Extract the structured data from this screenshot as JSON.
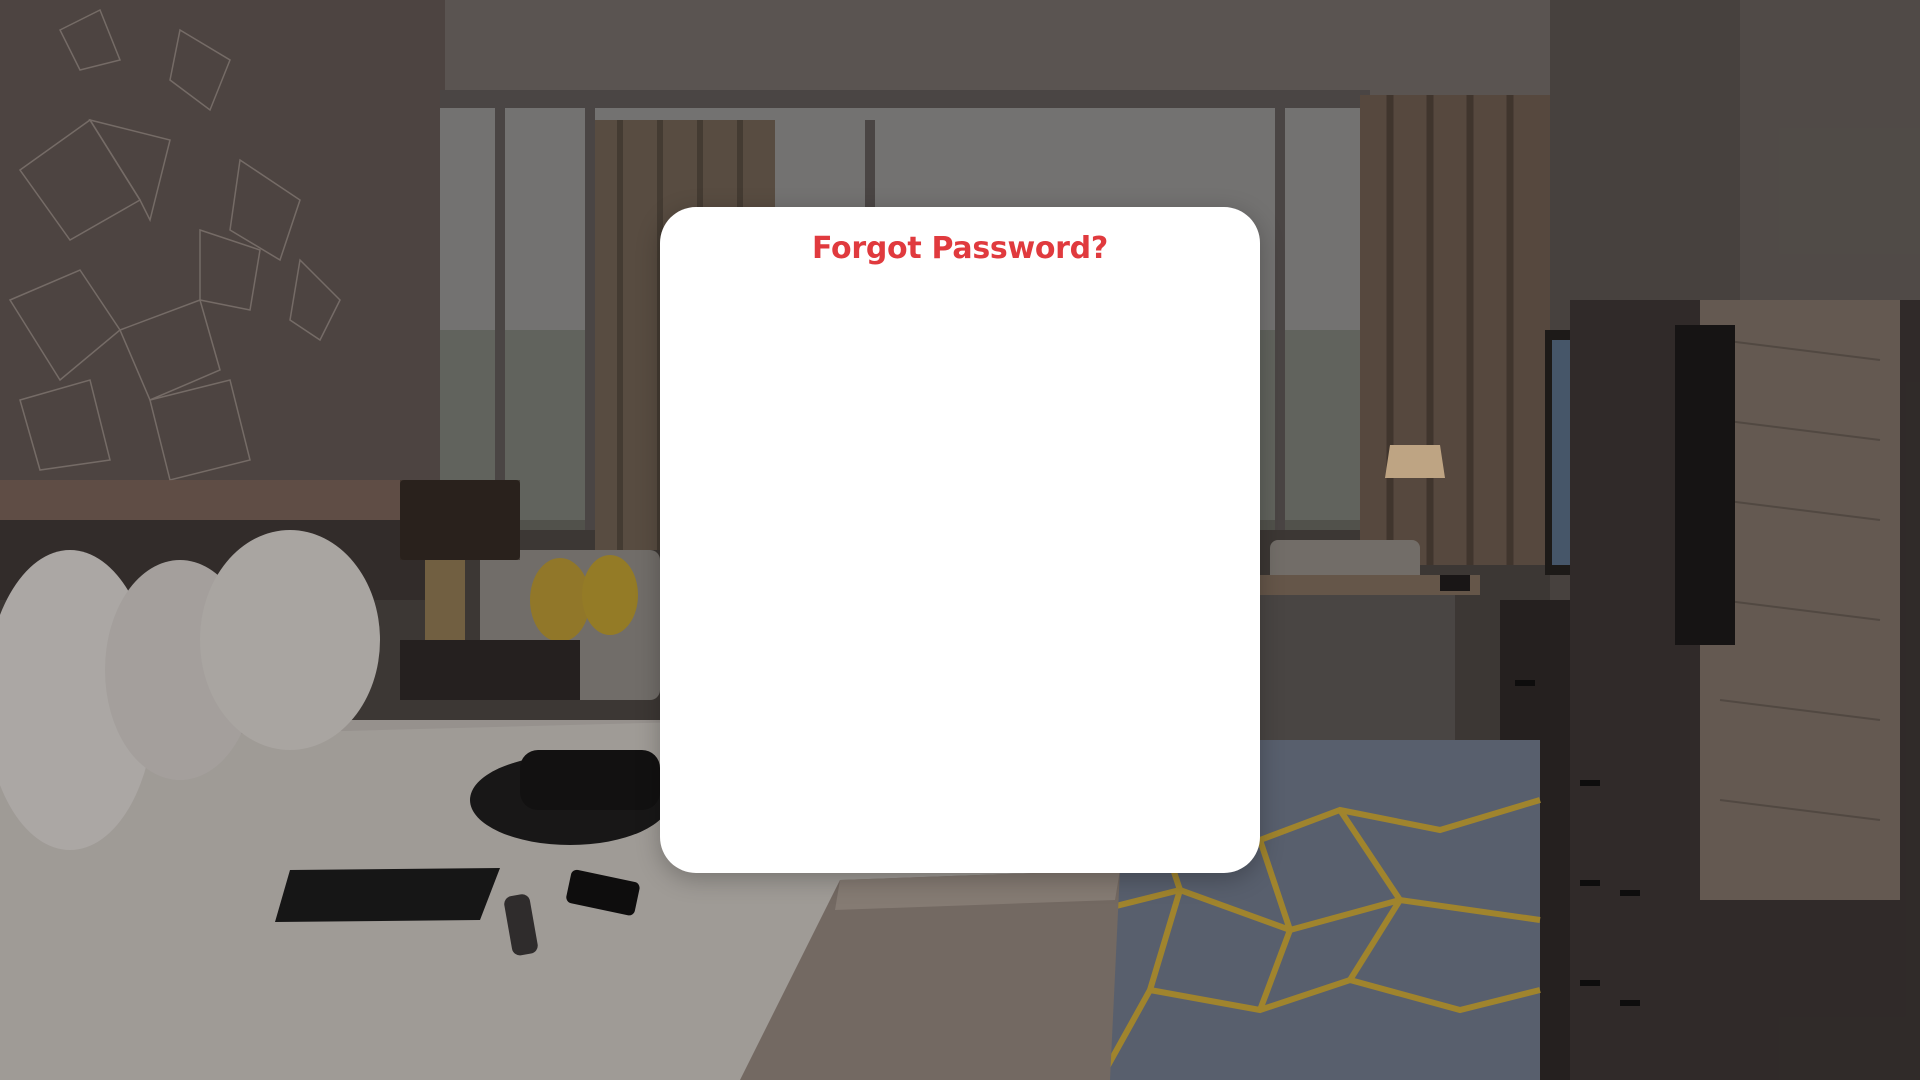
{
  "modal": {
    "title": "Forgot Password?"
  },
  "background": {
    "description_icon": "hotel-room-photo"
  },
  "colors": {
    "title_color": "#e03a3e",
    "modal_bg": "#ffffff"
  }
}
